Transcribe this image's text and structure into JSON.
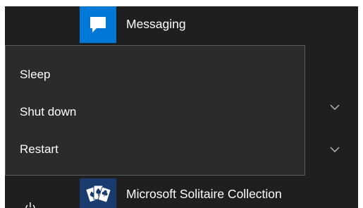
{
  "start_menu": {
    "apps": [
      {
        "label": "Messaging",
        "icon": "messaging-icon",
        "tile_color": "#0078d7"
      },
      {
        "label": "Microsoft Solitaire Collection",
        "icon": "solitaire-cards-icon",
        "tile_color": "#1a3b6e"
      }
    ],
    "expand_icons": [
      "chevron-down-icon",
      "chevron-down-icon"
    ],
    "power_icon": "power-icon"
  },
  "power_menu": {
    "items": [
      {
        "label": "Sleep"
      },
      {
        "label": "Shut down"
      },
      {
        "label": "Restart"
      }
    ]
  },
  "colors": {
    "background": "#1f1f1f",
    "menu_background": "#2b2b2b",
    "menu_border": "#5d5d5d",
    "accent": "#0078d7"
  }
}
